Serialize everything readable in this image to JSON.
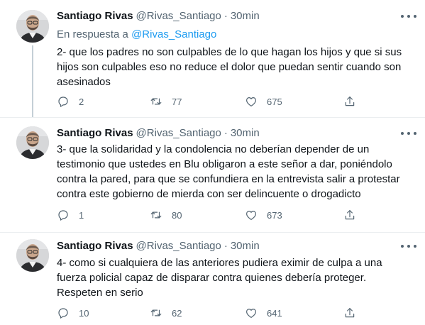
{
  "tweets": [
    {
      "name": "Santiago Rivas",
      "handle": "@Rivas_Santiago",
      "separator": "·",
      "time": "30min",
      "reply_prefix": "En respuesta a",
      "reply_handle": "@Rivas_Santiago",
      "text": "2- que los padres no son culpables de lo que hagan los hijos y que si sus hijos son culpables eso no reduce el dolor que puedan sentir cuando son asesinados",
      "replies": "2",
      "retweets": "77",
      "likes": "675"
    },
    {
      "name": "Santiago Rivas",
      "handle": "@Rivas_Santiago",
      "separator": "·",
      "time": "30min",
      "text": "3- que la solidaridad y la condolencia no deberían depender de un testimonio que ustedes en Blu obligaron a este señor a dar, poniéndolo contra la pared, para que se confundiera en la entrevista salir a protestar contra este gobierno de mierda con ser delincuente o drogadicto",
      "replies": "1",
      "retweets": "80",
      "likes": "673"
    },
    {
      "name": "Santiago Rivas",
      "handle": "@Rivas_Santiago",
      "separator": "·",
      "time": "30min",
      "text": "4- como si cualquiera de las anteriores pudiera eximir de culpa a una fuerza policial capaz de disparar contra quienes debería proteger. Respeten en serio",
      "replies": "10",
      "retweets": "62",
      "likes": "641"
    }
  ],
  "icons": {
    "reply": "reply-icon",
    "retweet": "retweet-icon",
    "like": "heart-icon",
    "share": "share-icon",
    "more": "more-icon"
  },
  "colors": {
    "link": "#1d9bf0",
    "secondary_text": "#536471",
    "thread_line": "#c4cfd6",
    "divider": "#ebeef0"
  }
}
